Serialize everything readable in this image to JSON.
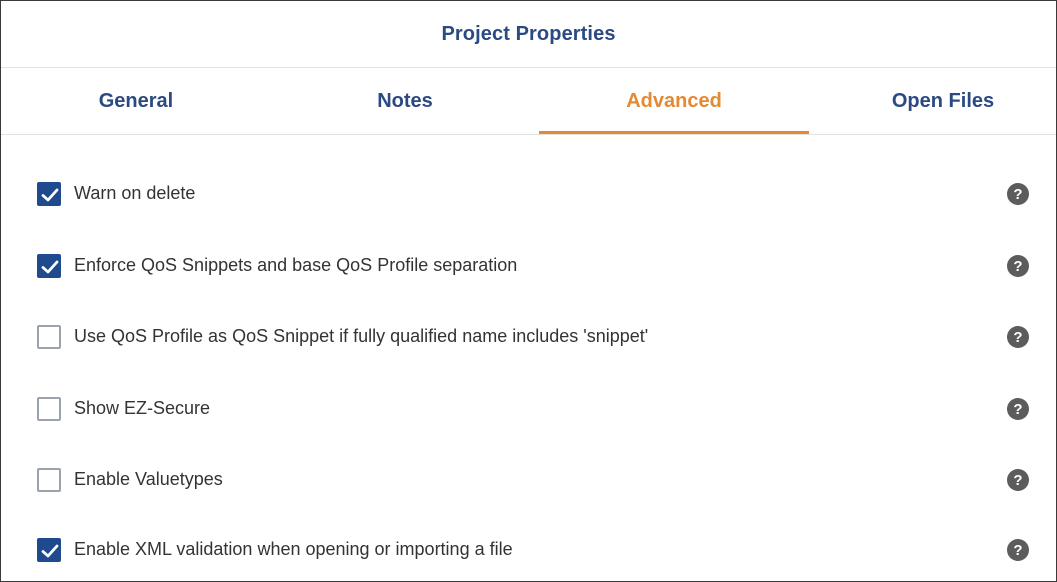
{
  "dialog": {
    "title": "Project Properties"
  },
  "tabs": [
    {
      "label": "General",
      "active": false
    },
    {
      "label": "Notes",
      "active": false
    },
    {
      "label": "Advanced",
      "active": true
    },
    {
      "label": "Open Files",
      "active": false
    }
  ],
  "options": [
    {
      "label": "Warn on delete",
      "checked": true,
      "help_glyph": "?"
    },
    {
      "label": "Enforce QoS Snippets and base QoS Profile separation",
      "checked": true,
      "help_glyph": "?"
    },
    {
      "label": "Use QoS Profile as QoS Snippet if fully qualified name includes 'snippet'",
      "checked": false,
      "help_glyph": "?"
    },
    {
      "label": "Show EZ-Secure",
      "checked": false,
      "help_glyph": "?"
    },
    {
      "label": "Enable Valuetypes",
      "checked": false,
      "help_glyph": "?"
    },
    {
      "label": "Enable XML validation when opening or importing a file",
      "checked": true,
      "help_glyph": "?"
    }
  ],
  "colors": {
    "title_text": "#2b4a83",
    "active_tab": "#e38a33",
    "checkbox_checked": "#1f4b8e",
    "checkbox_unchecked_border": "#9aa3ad",
    "help_icon": "#5c5c5c"
  },
  "icons": {
    "checkmark": "checkmark-icon",
    "help": "help-icon"
  }
}
